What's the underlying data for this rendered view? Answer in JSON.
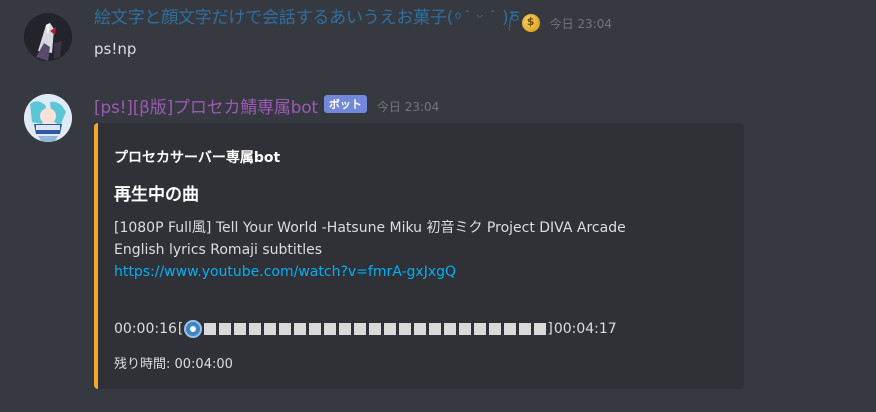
{
  "messages": [
    {
      "username": "絵文字と顔文字だけで会話するあいうえお菓子( ͦ ˙ ᵕ ˙ )ཎ",
      "username_color": "#2f6f9f",
      "badge_icon": "money-bag-icon",
      "timestamp": "今日 23:04",
      "content": "ps!np"
    },
    {
      "username": "[ps!][β版]プロセカ鯖専属bot",
      "username_color": "#9b59b6",
      "bot_tag": "ボット",
      "timestamp": "今日 23:04",
      "embed": {
        "accent_color": "#f4a52d",
        "author": "プロセカサーバー専属bot",
        "title": "再生中の曲",
        "description_line1": "[1080P Full風] Tell Your World -Hatsune Miku 初音ミク Project DIVA Arcade",
        "description_line2": "English lyrics Romaji subtitles",
        "link": "https://www.youtube.com/watch?v=fmrA-gxJxgQ",
        "progress": {
          "elapsed": "00:00:16",
          "total": "00:04:17",
          "bracket_open": "[",
          "bracket_close": "]",
          "position_fraction": 0.06
        },
        "remaining": "残り時間: 00:04:00"
      }
    }
  ]
}
